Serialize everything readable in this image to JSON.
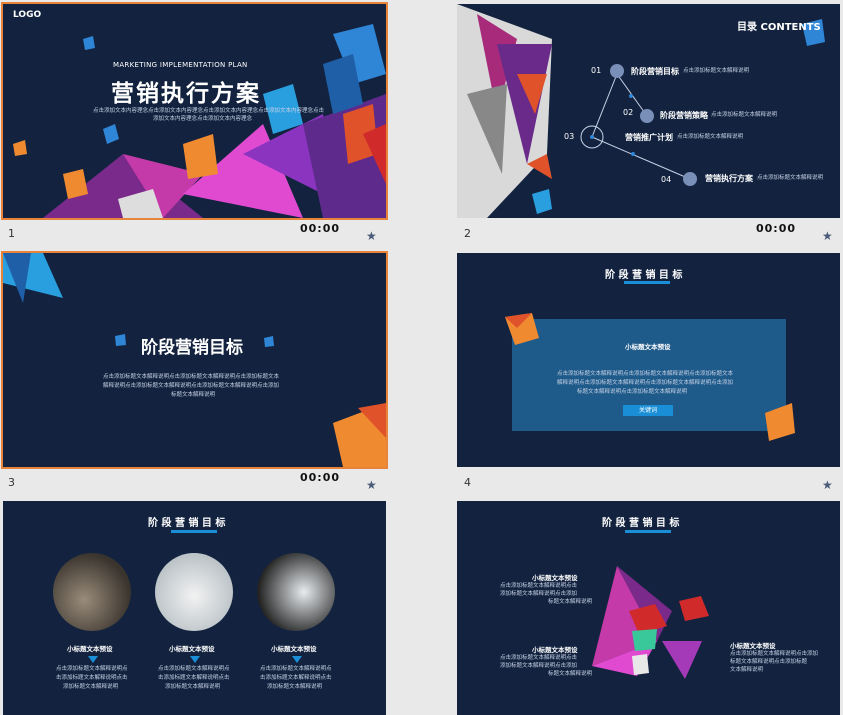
{
  "slides": [
    {
      "number": "1",
      "time": "00:00",
      "logo": "LOGO",
      "subtitle": "MARKETING IMPLEMENTATION PLAN",
      "title": "营销执行方案",
      "desc1": "点击添加文本内容理念点击添加文本内容理念点击添加文本内容理念点击添加文本内容理念点击",
      "desc2": "添加文本内容理念点击添加文本内容理念"
    },
    {
      "number": "2",
      "time": "00:00",
      "heading": "目录 CONTENTS",
      "items": [
        {
          "num": "01",
          "label": "阶段营销目标",
          "desc": "点击添加标题文本解释说明"
        },
        {
          "num": "02",
          "label": "阶段营销策略",
          "desc": "点击添加标题文本解释说明"
        },
        {
          "num": "03",
          "label": "营销推广计划",
          "desc": "点击添加标题文本解释说明"
        },
        {
          "num": "04",
          "label": "营销执行方案",
          "desc": "点击添加标题文本解释说明"
        }
      ]
    },
    {
      "number": "3",
      "time": "00:00",
      "title": "阶段营销目标",
      "desc": [
        "点击添加标题文本解释说明点击添加标题文本解释说明点击添加标题文本",
        "解释说明点击添加标题文本解释说明点击添加标题文本解释说明点击添加",
        "标题文本解释说明"
      ]
    },
    {
      "number": "4",
      "time": "",
      "heading": "阶 段 营 销 目 标",
      "box_title": "小标题文本预设",
      "box_desc": [
        "点击添加标题文本解释说明点击添加标题文本解释说明点击添加标题文本",
        "解释说明点击添加标题文本解释说明点击添加标题文本解释说明点击添加",
        "标题文本解释说明点击添加标题文本解释说明"
      ],
      "button": "关键词"
    },
    {
      "number": "",
      "time": "",
      "heading": "阶 段 营 销 目 标",
      "cols": [
        {
          "title": "小标题文本预设",
          "desc": [
            "点击添加标题文本解释说明点",
            "击添加标题文本解释说明点击",
            "添加标题文本解释说明"
          ]
        },
        {
          "title": "小标题文本预设",
          "desc": [
            "点击添加标题文本解释说明点",
            "击添加标题文本解释说明点击",
            "添加标题文本解释说明"
          ]
        },
        {
          "title": "小标题文本预设",
          "desc": [
            "点击添加标题文本解释说明点",
            "击添加标题文本解释说明点击",
            "添加标题文本解释说明"
          ]
        }
      ]
    },
    {
      "number": "",
      "time": "",
      "heading": "阶 段 营 销 目 标",
      "blocks": [
        {
          "title": "小标题文本预设",
          "desc": [
            "点击添加标题文本解释说明点击",
            "添加标题文本解释说明点击添加",
            "标题文本解释说明"
          ]
        },
        {
          "title": "小标题文本预设",
          "desc": [
            "点击添加标题文本解释说明点击",
            "添加标题文本解释说明点击添加",
            "标题文本解释说明"
          ]
        },
        {
          "title": "小标题文本预设",
          "desc": [
            "点击添加标题文本解释说明点击添加",
            "标题文本解释说明点击添加标题",
            "文本解释说明"
          ]
        }
      ]
    }
  ],
  "icons": {
    "star": "star-icon"
  },
  "colors": {
    "bg": "#13233f",
    "accent": "#e8833a",
    "blue": "#1a8fd8"
  }
}
